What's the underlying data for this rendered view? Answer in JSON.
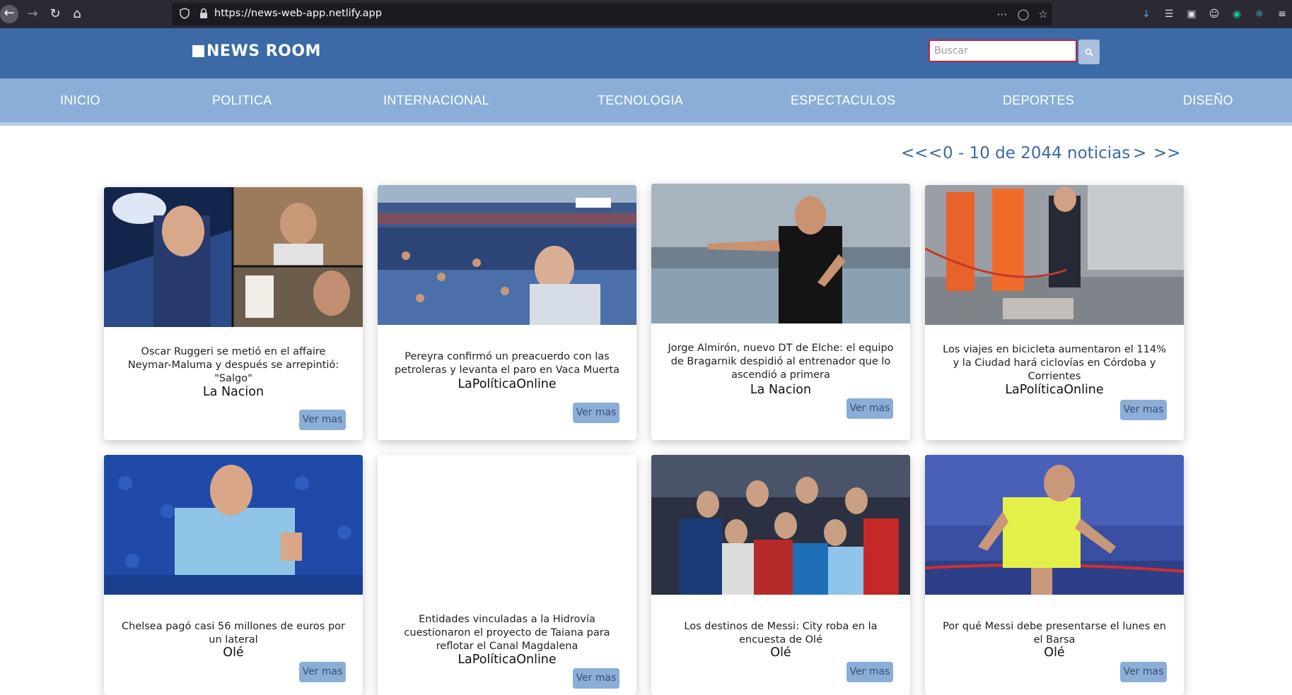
{
  "browser": {
    "url": "https://news-web-app.netlify.app"
  },
  "header": {
    "logo": "NEWS ROOM",
    "search_placeholder": "Buscar"
  },
  "nav": {
    "items": [
      {
        "label": "INICIO"
      },
      {
        "label": "POLITICA"
      },
      {
        "label": "INTERNACIONAL"
      },
      {
        "label": "TECNOLOGIA"
      },
      {
        "label": "ESPECTACULOS"
      },
      {
        "label": "DEPORTES"
      },
      {
        "label": "DISEÑO"
      }
    ]
  },
  "pagination": {
    "first": "<<",
    "prev": "<",
    "range": "0 - 10 de 2044 noticias",
    "next": ">",
    "last": ">>"
  },
  "colors": {
    "header": "#3b6aa6",
    "nav": "#8aaed8",
    "button": "#8aaed8",
    "pagination": "#3b6aa6"
  },
  "cards": [
    {
      "title": "Oscar Ruggeri se metió en el affaire Neymar-Maluma y después se arrepintió: \"Salgo\"",
      "source": "La Nacion",
      "button": "Ver mas"
    },
    {
      "title": "Pereyra confirmó un preacuerdo con las petroleras y levanta el paro en Vaca Muerta",
      "source": "LaPolíticaOnline",
      "button": "Ver mas"
    },
    {
      "title": "Jorge Almirón, nuevo DT de Elche: el equipo de Bragarnik despidió al entrenador que lo ascendió a primera",
      "source": "La Nacion",
      "button": "Ver mas"
    },
    {
      "title": "Los viajes en bicicleta aumentaron el 114% y la Ciudad hará ciclovías en Córdoba y Corrientes",
      "source": "LaPolíticaOnline",
      "button": "Ver mas"
    },
    {
      "title": "Chelsea pagó casi 56 millones de euros por un lateral",
      "source": "Olé",
      "button": "Ver mas"
    },
    {
      "title": "Entidades vinculadas a la Hidrovía cuestionaron el proyecto de Taiana para reflotar el Canal Magdalena",
      "source": "LaPolíticaOnline",
      "button": "Ver mas"
    },
    {
      "title": "Los destinos de Messi: City roba en la encuesta de Olé",
      "source": "Olé",
      "button": "Ver mas"
    },
    {
      "title": "Por qué Messi debe presentarse el lunes en el Barsa",
      "source": "Olé",
      "button": "Ver mas"
    }
  ]
}
